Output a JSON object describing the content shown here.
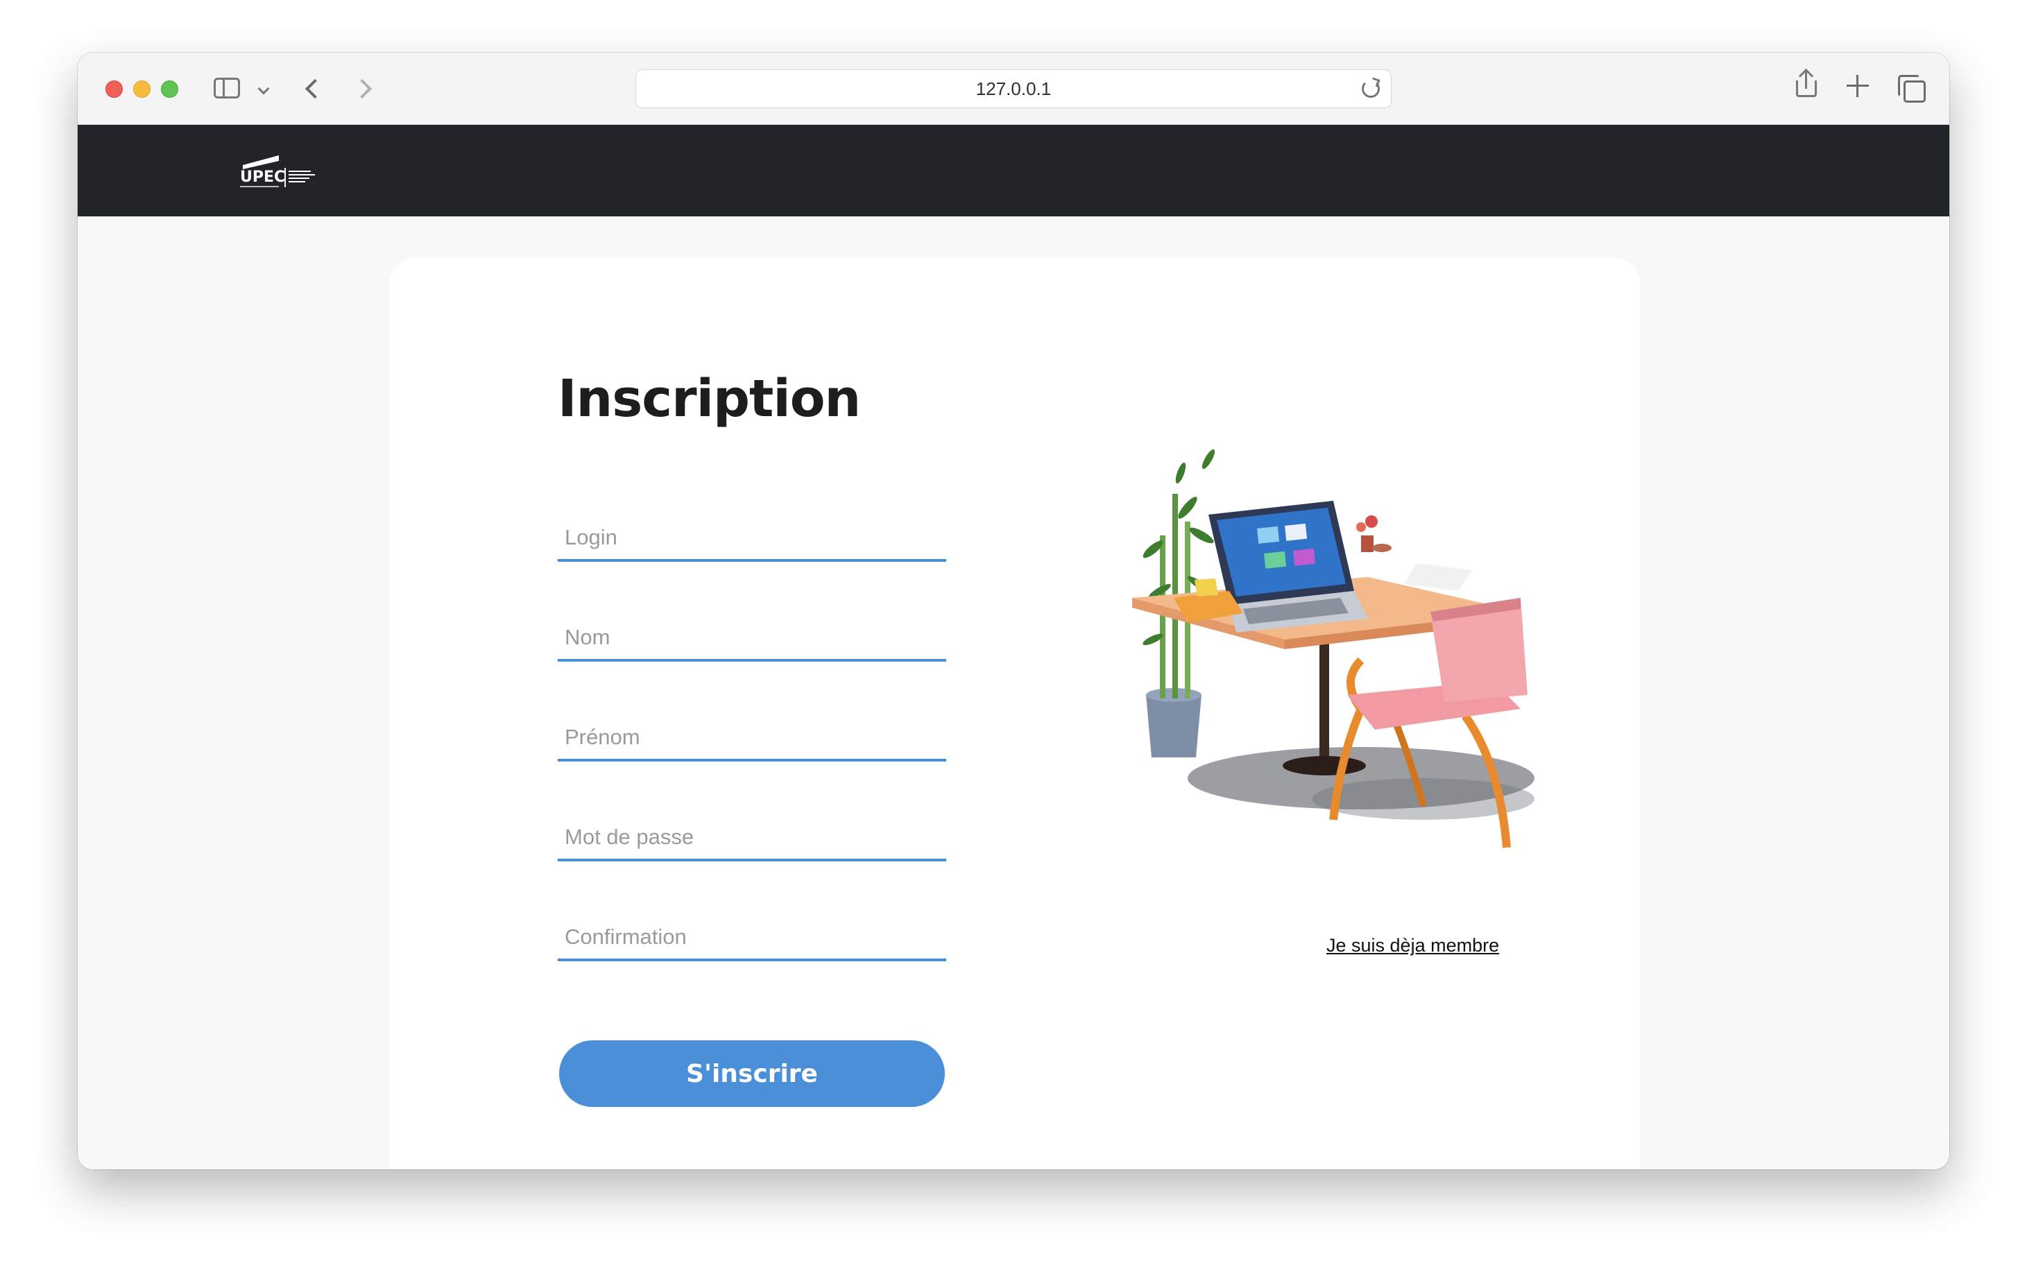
{
  "browser": {
    "url": "127.0.0.1"
  },
  "header": {
    "logo_text": "UPEC"
  },
  "form": {
    "title": "Inscription",
    "fields": [
      {
        "name": "login",
        "placeholder": "Login",
        "type": "text"
      },
      {
        "name": "nom",
        "placeholder": "Nom",
        "type": "text"
      },
      {
        "name": "prenom",
        "placeholder": "Prénom",
        "type": "text"
      },
      {
        "name": "mot_de_passe",
        "placeholder": "Mot de passe",
        "type": "password"
      },
      {
        "name": "confirmation",
        "placeholder": "Confirmation",
        "type": "password"
      }
    ],
    "submit_label": "S'inscrire"
  },
  "aside": {
    "member_link": "Je suis dèja membre"
  },
  "colors": {
    "accent": "#4a8fd8",
    "header_bg": "#212529",
    "page_bg": "#f8f8f8",
    "card_bg": "#ffffff",
    "title": "#1d1d1d"
  },
  "icons": [
    "sidebar-icon",
    "chevron-down-icon",
    "back-icon",
    "forward-icon",
    "reload-icon",
    "share-icon",
    "new-tab-icon",
    "tabs-overview-icon"
  ]
}
